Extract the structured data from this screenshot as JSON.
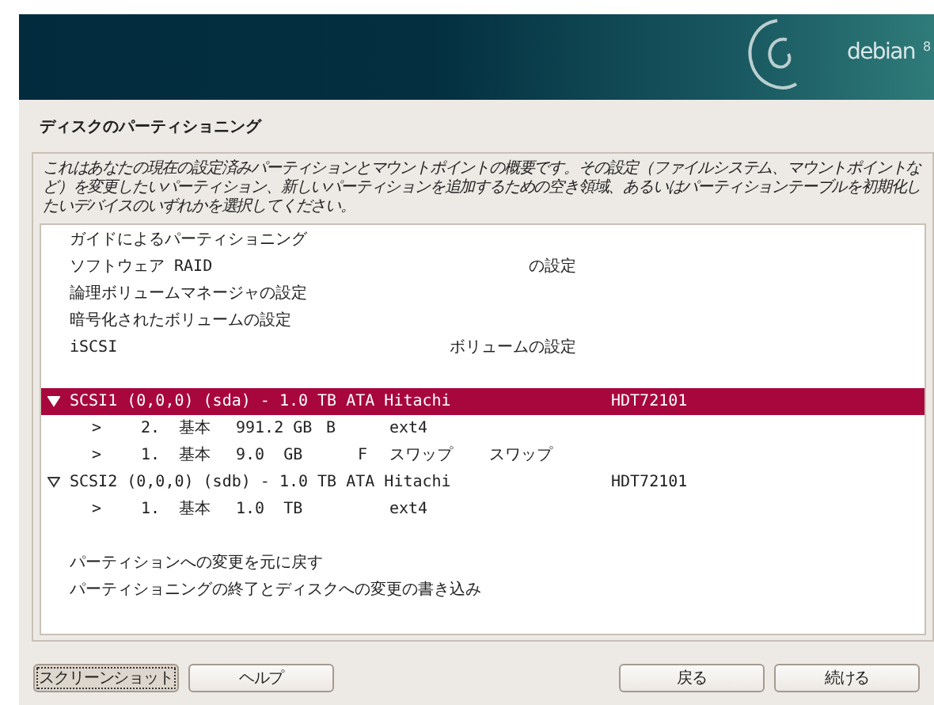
{
  "header": {
    "brand": "debian",
    "version": "8"
  },
  "title": "ディスクのパーティショニング",
  "description": "これはあなたの現在の設定済みパーティションとマウントポイントの概要です。その設定（ファイルシステム、マウントポイントなど）を変更したいパーティション、新しいパーティションを追加するための空き領域、あるいはパーティションテーブルを初期化したいデバイスのいずれかを選択してください。",
  "rows": [
    {
      "kind": "action",
      "label": "ガイドによるパーティショニング",
      "selected": false
    },
    {
      "kind": "action",
      "label": "ソフトウェア RAID",
      "suffix": "の設定",
      "selected": false
    },
    {
      "kind": "action",
      "label": "論理ボリュームマネージャの設定",
      "selected": false
    },
    {
      "kind": "action",
      "label": "暗号化されたボリュームの設定",
      "selected": false
    },
    {
      "kind": "action",
      "label": "iSCSI",
      "suffix": "ボリュームの設定",
      "selected": false
    },
    {
      "kind": "blank"
    },
    {
      "kind": "disk",
      "label": "SCSI1 (0,0,0) (sda) - 1.0 TB ATA Hitachi",
      "model": "HDT72101",
      "expanded": true,
      "selected": true
    },
    {
      "kind": "partition",
      "marker": ">",
      "number": "2.",
      "type": "基本",
      "size": "991.2 GB",
      "boot": "B",
      "filesystem": "ext4",
      "selected": false
    },
    {
      "kind": "partition",
      "marker": ">",
      "number": "1.",
      "type": "基本",
      "size": "9.0  GB",
      "format": "F",
      "filesystem": "スワップ",
      "mount": "スワップ",
      "selected": false
    },
    {
      "kind": "disk",
      "label": "SCSI2 (0,0,0) (sdb) - 1.0 TB ATA Hitachi",
      "model": "HDT72101",
      "expanded": true,
      "selected": false
    },
    {
      "kind": "partition",
      "marker": ">",
      "number": "1.",
      "type": "基本",
      "size": "1.0  TB",
      "filesystem": "ext4",
      "selected": false
    },
    {
      "kind": "blank"
    },
    {
      "kind": "action",
      "label": "パーティションへの変更を元に戻す",
      "selected": false
    },
    {
      "kind": "action",
      "label": "パーティショニングの終了とディスクへの変更の書き込み",
      "selected": false
    }
  ],
  "buttons_left": [
    {
      "label": "スクリーンショット",
      "focused": true
    },
    {
      "label": "ヘルプ",
      "focused": false
    }
  ],
  "buttons_right": [
    {
      "label": "戻る",
      "focused": false
    },
    {
      "label": "続ける",
      "focused": false
    }
  ]
}
